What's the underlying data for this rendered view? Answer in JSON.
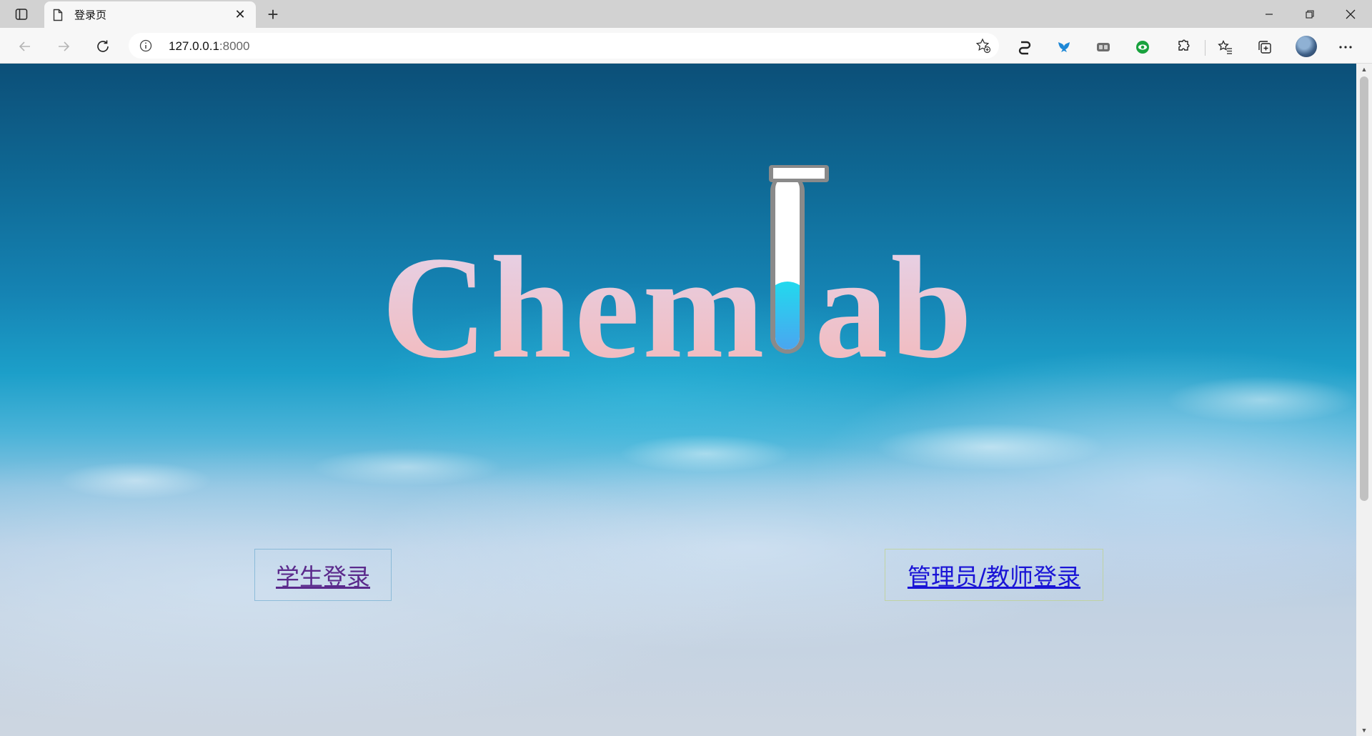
{
  "browser": {
    "tab": {
      "title": "登录页"
    },
    "address_bar": {
      "host": "127.0.0.1",
      "port": ":8000"
    }
  },
  "page": {
    "logo": {
      "text_left": "Chem",
      "text_right": "ab"
    },
    "links": {
      "student_login": "学生登录",
      "staff_login": "管理员/教师登录"
    }
  }
}
